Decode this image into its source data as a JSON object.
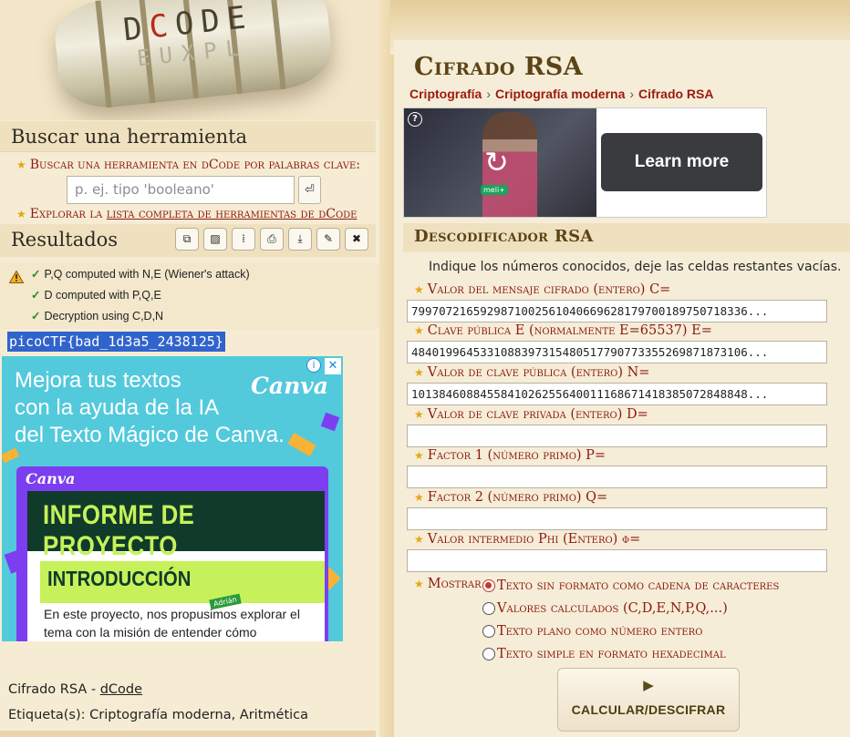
{
  "logo": {
    "text_top": "DCODE",
    "text_bottom": "EUXPL"
  },
  "search": {
    "title": "Buscar una herramienta",
    "hint": "Buscar una herramienta en dCode por palabras clave:",
    "placeholder": "p. ej. tipo 'booleano'",
    "go_icon": "enter-arrow-icon",
    "explore_prefix": "Explorar la",
    "explore_link": "lista completa de herramientas de dCode"
  },
  "results": {
    "title": "Resultados",
    "tools": [
      "⧉",
      "▨",
      "⁞",
      "⎙",
      "⤓",
      "✎",
      "✖"
    ],
    "lines": [
      "P,Q computed with N,E (Wiener's attack)",
      "D computed with P,Q,E",
      "Decryption using C,D,N"
    ],
    "flag": "picoCTF{bad_1d3a5_2438125}"
  },
  "ad_left": {
    "headline_lines": [
      "Mejora tus textos",
      "con la ayuda de la IA",
      "del Texto Mágico de Canva."
    ],
    "brand": "Canva",
    "card_brand": "Canva",
    "card_title": "INFORME DE PROYECTO",
    "card_subtitle": "INTRODUCCIÓN",
    "card_body": "En este proyecto, nos propusimos explorar el tema con la misión de entender cómo",
    "tag": "Adrián",
    "info_icon": "i",
    "close_icon": "✕"
  },
  "footer": {
    "line1_text": "Cifrado RSA - ",
    "line1_link": "dCode",
    "line2": "Etiqueta(s): Criptografía moderna, Aritmética"
  },
  "page": {
    "title": "Cifrado RSA",
    "breadcrumb": [
      "Criptografía",
      "Criptografía moderna",
      "Cifrado RSA"
    ]
  },
  "ad_right": {
    "cta": "Learn more",
    "badge": "meli+"
  },
  "decoder": {
    "title": "Descodificador RSA",
    "intro": "Indique los números conocidos, deje las celdas restantes vacías.",
    "fields": [
      {
        "label": "Valor del mensaje cifrado (entero) C=",
        "value": "7997072165929871002561040669628179700189750718336..."
      },
      {
        "label": "Clave pública E (normalmente E=65537) E=",
        "value": "4840199645331088397315480517790773355269871873106..."
      },
      {
        "label": "Valor de clave pública (entero) N=",
        "value": "1013846088455841026255640011168671418385072848848..."
      },
      {
        "label": "Valor de clave privada (entero) D=",
        "value": ""
      },
      {
        "label": "Factor 1 (número primo) P=",
        "value": ""
      },
      {
        "label": "Factor 2 (número primo) Q=",
        "value": ""
      },
      {
        "label": "Valor intermedio Phi (Entero) φ=",
        "value": ""
      }
    ],
    "show_label": "Mostrar",
    "options": [
      "Texto sin formato como cadena de caracteres",
      "Valores calculados (C,D,E,N,P,Q,...)",
      "Texto plano como número entero",
      "Texto simple en formato hexadecimal"
    ],
    "selected_option": "Texto sin formato como cadena de caracteres",
    "submit_label": "CALCULAR/DESCIFRAR",
    "submit_icon": "▶"
  },
  "colors": {
    "accent_red": "#8b1a10",
    "title_brown": "#5b4416",
    "page_bg": "#f3e6c8",
    "flag_highlight": "#3063cc"
  }
}
